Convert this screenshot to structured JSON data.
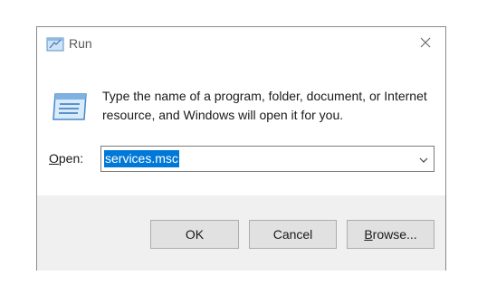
{
  "window": {
    "title": "Run",
    "close_icon": "close-icon"
  },
  "description": "Type the name of a program, folder, document, or Internet resource, and Windows will open it for you.",
  "open_field": {
    "label_first": "O",
    "label_rest": "pen:",
    "value": "services.msc",
    "selected": true
  },
  "buttons": {
    "ok": "OK",
    "cancel": "Cancel",
    "browse_first": "B",
    "browse_rest": "rowse..."
  },
  "colors": {
    "selection": "#0078d7",
    "footer_bg": "#f0f0f0",
    "button_bg": "#e1e1e1"
  }
}
